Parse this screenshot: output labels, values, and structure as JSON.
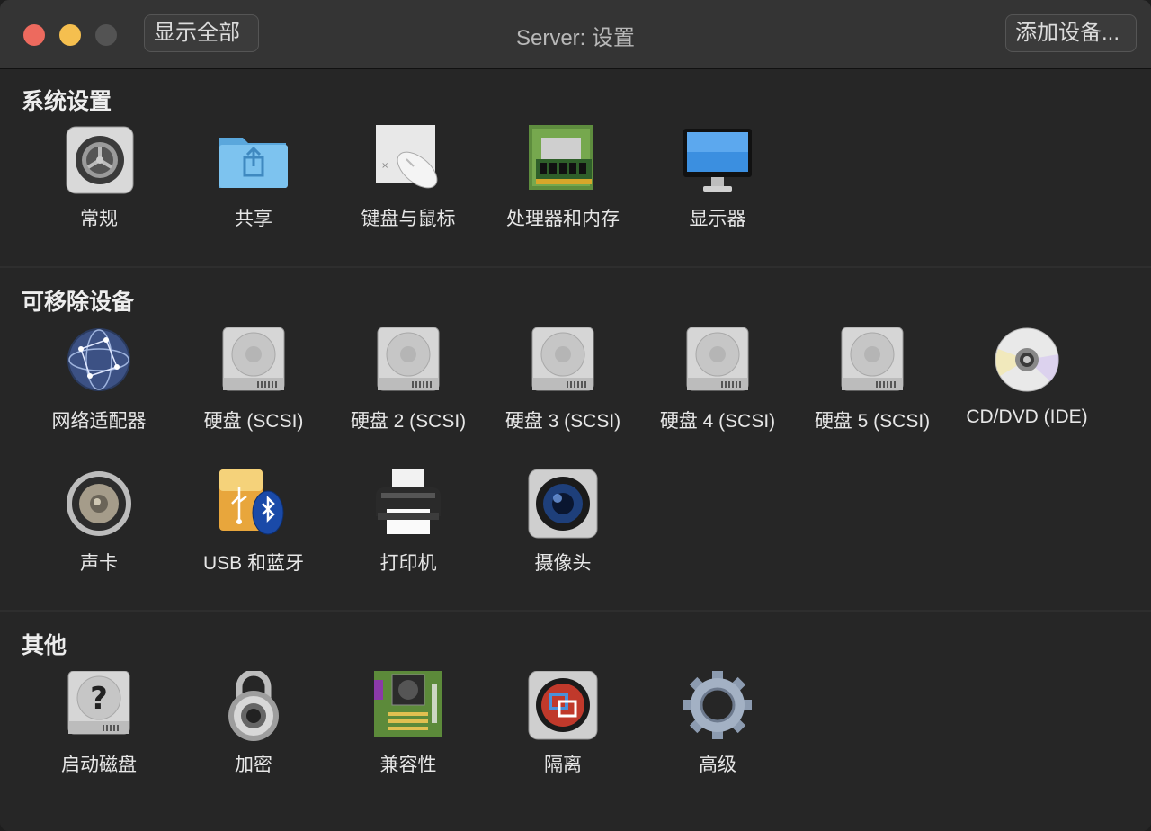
{
  "window": {
    "title": "Server: 设置"
  },
  "toolbar": {
    "show_all_label": "显示全部",
    "add_device_label": "添加设备..."
  },
  "sections": {
    "system": {
      "title": "系统设置",
      "items": [
        {
          "label": "常规",
          "icon": "general-gear-icon"
        },
        {
          "label": "共享",
          "icon": "shared-folder-icon"
        },
        {
          "label": "键盘与鼠标",
          "icon": "keyboard-mouse-icon"
        },
        {
          "label": "处理器和内存",
          "icon": "memory-chip-icon"
        },
        {
          "label": "显示器",
          "icon": "display-monitor-icon"
        }
      ]
    },
    "removable": {
      "title": "可移除设备",
      "items": [
        {
          "label": "网络适配器",
          "icon": "network-globe-icon"
        },
        {
          "label": "硬盘 (SCSI)",
          "icon": "hard-disk-icon"
        },
        {
          "label": "硬盘 2 (SCSI)",
          "icon": "hard-disk-icon"
        },
        {
          "label": "硬盘 3 (SCSI)",
          "icon": "hard-disk-icon"
        },
        {
          "label": "硬盘 4 (SCSI)",
          "icon": "hard-disk-icon"
        },
        {
          "label": "硬盘 5 (SCSI)",
          "icon": "hard-disk-icon"
        },
        {
          "label": "CD/DVD (IDE)",
          "icon": "cd-dvd-icon"
        },
        {
          "label": "声卡",
          "icon": "speaker-icon"
        },
        {
          "label": "USB 和蓝牙",
          "icon": "usb-bluetooth-icon"
        },
        {
          "label": "打印机",
          "icon": "printer-icon"
        },
        {
          "label": "摄像头",
          "icon": "camera-icon"
        }
      ]
    },
    "other": {
      "title": "其他",
      "items": [
        {
          "label": "启动磁盘",
          "icon": "startup-disk-icon"
        },
        {
          "label": "加密",
          "icon": "padlock-icon"
        },
        {
          "label": "兼容性",
          "icon": "motherboard-icon"
        },
        {
          "label": "隔离",
          "icon": "isolation-icon"
        },
        {
          "label": "高级",
          "icon": "advanced-gear-icon"
        }
      ]
    }
  },
  "colors": {
    "close": "#ed6a5e",
    "minimize": "#f5bf4f",
    "maximize_disabled": "#535353",
    "background": "#262626",
    "titlebar": "#343434"
  }
}
